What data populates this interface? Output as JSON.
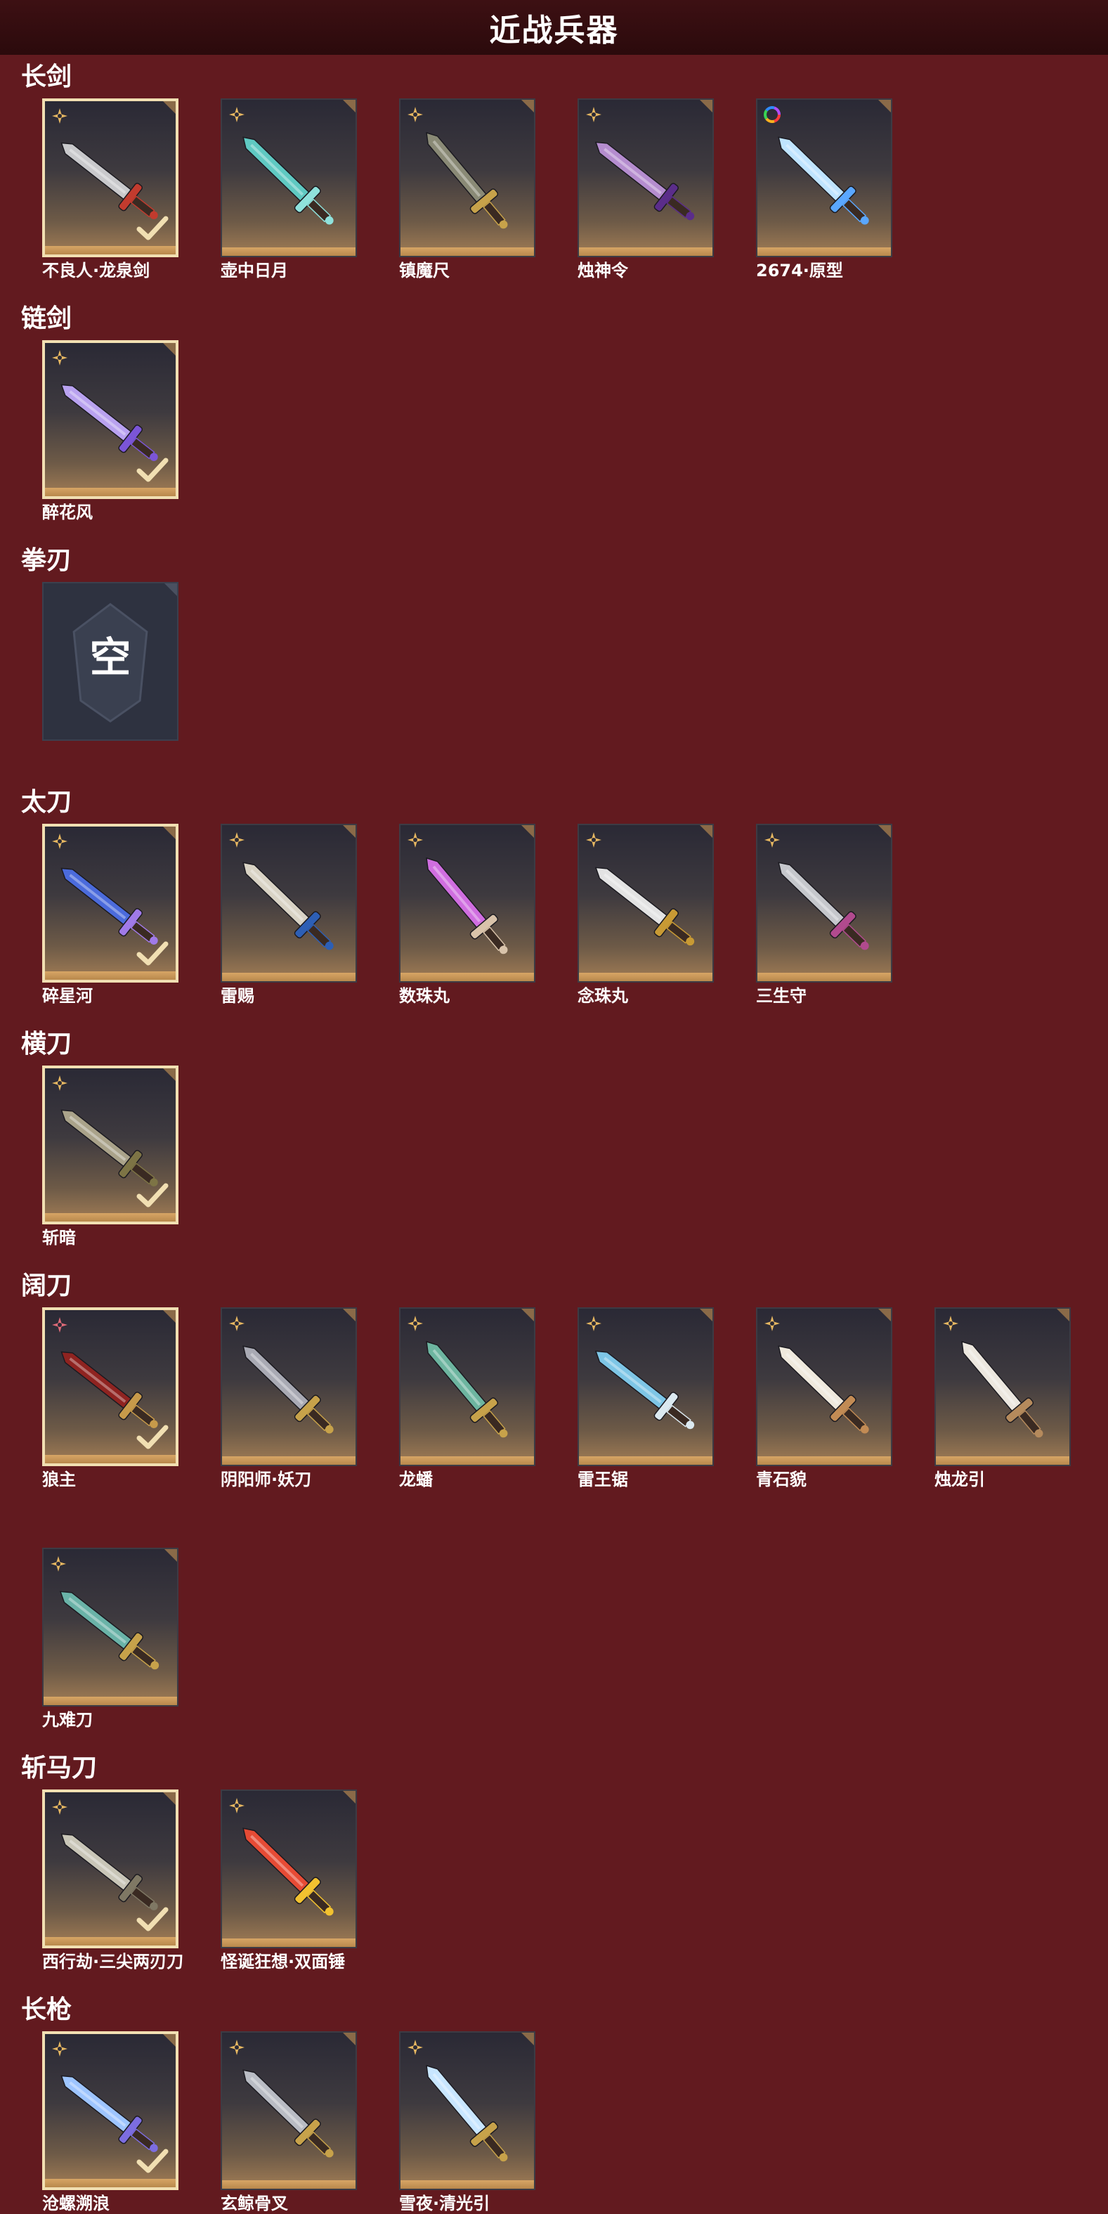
{
  "header": {
    "title": "近战兵器"
  },
  "colors": {
    "background": "#621a1f",
    "header_bg": "#2b0a0c",
    "selected_border": "#f1dfb2",
    "card_bottom_bar": "#c9965a",
    "rank_gold": "#e6b761",
    "rank_pink": "#e06b78"
  },
  "categories": [
    {
      "name": "长剑",
      "items": [
        {
          "name": "不良人·龙泉剑",
          "selected": true,
          "rank_icon": "gold-star-icon",
          "blade": "#c9c9cc",
          "accent": "#c23b2e"
        },
        {
          "name": "壶中日月",
          "selected": false,
          "rank_icon": "gold-star-icon",
          "blade": "#5fc9c2",
          "accent": "#8fe2dc"
        },
        {
          "name": "镇魔尺",
          "selected": false,
          "rank_icon": "gold-star-icon",
          "blade": "#8a8a76",
          "accent": "#c7a24a"
        },
        {
          "name": "烛神令",
          "selected": false,
          "rank_icon": "gold-star-icon",
          "blade": "#b58dcf",
          "accent": "#5b2d8a"
        },
        {
          "name": "2674·原型",
          "selected": false,
          "rank_icon": "rainbow-ring-icon",
          "blade": "#bfe4ff",
          "accent": "#5aa7ff"
        }
      ]
    },
    {
      "name": "链剑",
      "items": [
        {
          "name": "醉花风",
          "selected": true,
          "rank_icon": "gold-star-icon",
          "blade": "#b9a2f0",
          "accent": "#7b55d6"
        }
      ]
    },
    {
      "name": "拳刃",
      "items": [
        {
          "name": "",
          "selected": false,
          "empty": true,
          "empty_text": "空"
        }
      ]
    },
    {
      "name": "太刀",
      "items": [
        {
          "name": "碎星河",
          "selected": true,
          "rank_icon": "gold-star-icon",
          "blade": "#4b6bdc",
          "accent": "#a07ae8"
        },
        {
          "name": "雷赐",
          "selected": false,
          "rank_icon": "gold-star-icon",
          "blade": "#d9d3c5",
          "accent": "#2d5fb5"
        },
        {
          "name": "数珠丸",
          "selected": false,
          "rank_icon": "gold-star-icon",
          "blade": "#d06ee0",
          "accent": "#d9c3aa"
        },
        {
          "name": "念珠丸",
          "selected": false,
          "rank_icon": "gold-star-icon",
          "blade": "#e3e3e3",
          "accent": "#c89a34"
        },
        {
          "name": "三生守",
          "selected": false,
          "rank_icon": "gold-star-icon",
          "blade": "#c5c7cc",
          "accent": "#b14a8e"
        }
      ]
    },
    {
      "name": "横刀",
      "items": [
        {
          "name": "斩暗",
          "selected": true,
          "rank_icon": "gold-star-icon",
          "blade": "#aaa38a",
          "accent": "#7d7445"
        }
      ]
    },
    {
      "name": "阔刀",
      "items": [
        {
          "name": "狼主",
          "selected": true,
          "rank_icon": "pink-flower-icon",
          "blade": "#8f2320",
          "accent": "#c79a4a"
        },
        {
          "name": "阴阳师·妖刀",
          "selected": false,
          "rank_icon": "gold-star-icon",
          "blade": "#a9aab4",
          "accent": "#c7a24a"
        },
        {
          "name": "龙蟠",
          "selected": false,
          "rank_icon": "gold-star-icon",
          "blade": "#6db5a0",
          "accent": "#c7a24a"
        },
        {
          "name": "雷王锯",
          "selected": false,
          "rank_icon": "gold-star-icon",
          "blade": "#7ec6e6",
          "accent": "#dbe9f0"
        },
        {
          "name": "青石貌",
          "selected": false,
          "rank_icon": "gold-star-icon",
          "blade": "#efe9dd",
          "accent": "#c28b54"
        },
        {
          "name": "烛龙引",
          "selected": false,
          "rank_icon": "gold-star-icon",
          "blade": "#ece7df",
          "accent": "#b58a5c"
        },
        {
          "name": "九难刀",
          "selected": false,
          "rank_icon": "gold-star-icon",
          "blade": "#6ab3a8",
          "accent": "#c7a24a"
        }
      ]
    },
    {
      "name": "斩马刀",
      "items": [
        {
          "name": "西行劫·三尖两刃刀",
          "selected": true,
          "rank_icon": "gold-star-icon",
          "blade": "#c9c6b8",
          "accent": "#7f7864"
        },
        {
          "name": "怪诞狂想·双面锤",
          "selected": false,
          "rank_icon": "gold-star-icon",
          "blade": "#e64b35",
          "accent": "#f2c230"
        }
      ]
    },
    {
      "name": "长枪",
      "items": [
        {
          "name": "沧螺溯浪",
          "selected": true,
          "rank_icon": "gold-star-icon",
          "blade": "#9ec5ff",
          "accent": "#7c6de0"
        },
        {
          "name": "玄鲸骨叉",
          "selected": false,
          "rank_icon": "gold-star-icon",
          "blade": "#b9bcc4",
          "accent": "#c7a24a"
        },
        {
          "name": "雪夜·清光引",
          "selected": false,
          "rank_icon": "gold-star-icon",
          "blade": "#c8e6ff",
          "accent": "#c7a24a"
        }
      ]
    }
  ]
}
